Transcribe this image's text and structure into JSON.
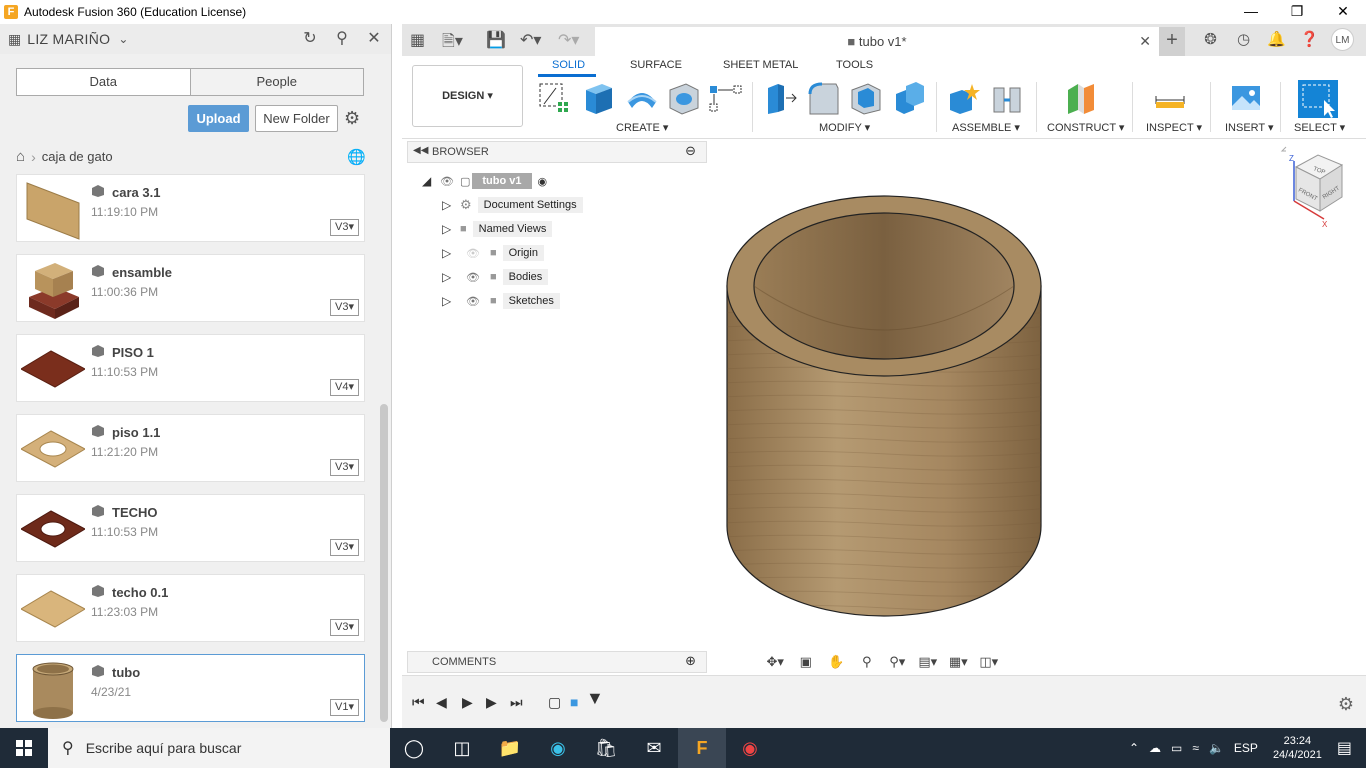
{
  "window": {
    "title": "Autodesk Fusion 360 (Education License)",
    "logo_letter": "F"
  },
  "data_panel": {
    "user_name": "LIZ MARIÑO",
    "tabs": [
      "Data",
      "People"
    ],
    "upload_label": "Upload",
    "new_folder_label": "New Folder",
    "breadcrumb": "caja de gato",
    "files": [
      {
        "name": "cara 3.1",
        "time": "11:19:10 PM",
        "version": "V3"
      },
      {
        "name": "ensamble",
        "time": "11:00:36 PM",
        "version": "V3"
      },
      {
        "name": "PISO 1",
        "time": "11:10:53 PM",
        "version": "V4"
      },
      {
        "name": "piso 1.1",
        "time": "11:21:20 PM",
        "version": "V3"
      },
      {
        "name": "TECHO",
        "time": "11:10:53 PM",
        "version": "V3"
      },
      {
        "name": "techo 0.1",
        "time": "11:23:03 PM",
        "version": "V3"
      },
      {
        "name": "tubo",
        "time": "4/23/21",
        "version": "V1"
      }
    ]
  },
  "document": {
    "tab_title": "tubo v1*",
    "avatar_initials": "LM"
  },
  "toolbar": {
    "workspace": "DESIGN",
    "tabs": [
      "SOLID",
      "SURFACE",
      "SHEET METAL",
      "TOOLS"
    ],
    "groups": [
      "CREATE",
      "MODIFY",
      "ASSEMBLE",
      "CONSTRUCT",
      "INSPECT",
      "INSERT",
      "SELECT"
    ]
  },
  "browser": {
    "title": "BROWSER",
    "root": "tubo v1",
    "items": [
      "Document Settings",
      "Named Views",
      "Origin",
      "Bodies",
      "Sketches"
    ]
  },
  "comments": {
    "title": "COMMENTS"
  },
  "viewcube": {
    "top": "TOP",
    "front": "FRONT",
    "right": "RIGHT",
    "axis_z": "Z",
    "axis_x": "X"
  },
  "taskbar": {
    "search_placeholder": "Escribe aquí para buscar",
    "lang": "ESP",
    "time": "23:24",
    "date": "24/4/2021"
  }
}
